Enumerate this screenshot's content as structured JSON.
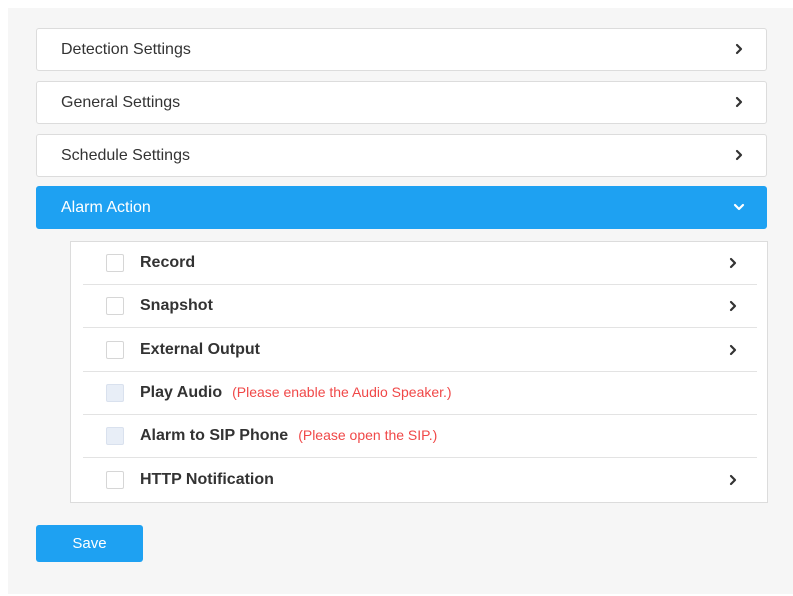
{
  "sections": [
    {
      "label": "Detection Settings",
      "expanded": false
    },
    {
      "label": "General Settings",
      "expanded": false
    },
    {
      "label": "Schedule Settings",
      "expanded": false
    },
    {
      "label": "Alarm Action",
      "expanded": true
    }
  ],
  "alarm_actions": [
    {
      "label": "Record",
      "note": "",
      "checked": false,
      "enabled": true,
      "has_submenu": true
    },
    {
      "label": "Snapshot",
      "note": "",
      "checked": false,
      "enabled": true,
      "has_submenu": true
    },
    {
      "label": "External Output",
      "note": "",
      "checked": false,
      "enabled": true,
      "has_submenu": true
    },
    {
      "label": "Play Audio",
      "note": "(Please enable the Audio Speaker.)",
      "checked": false,
      "enabled": false,
      "has_submenu": false
    },
    {
      "label": "Alarm to SIP Phone",
      "note": "(Please open the SIP.)",
      "checked": false,
      "enabled": false,
      "has_submenu": false
    },
    {
      "label": "HTTP Notification",
      "note": "",
      "checked": false,
      "enabled": true,
      "has_submenu": true
    }
  ],
  "save_label": "Save",
  "colors": {
    "accent": "#1ea1f2",
    "warning_text": "#f04848",
    "panel_bg": "#f6f6f6"
  },
  "icons": {
    "collapsed": "chevron-right-icon",
    "expanded": "chevron-down-icon"
  }
}
